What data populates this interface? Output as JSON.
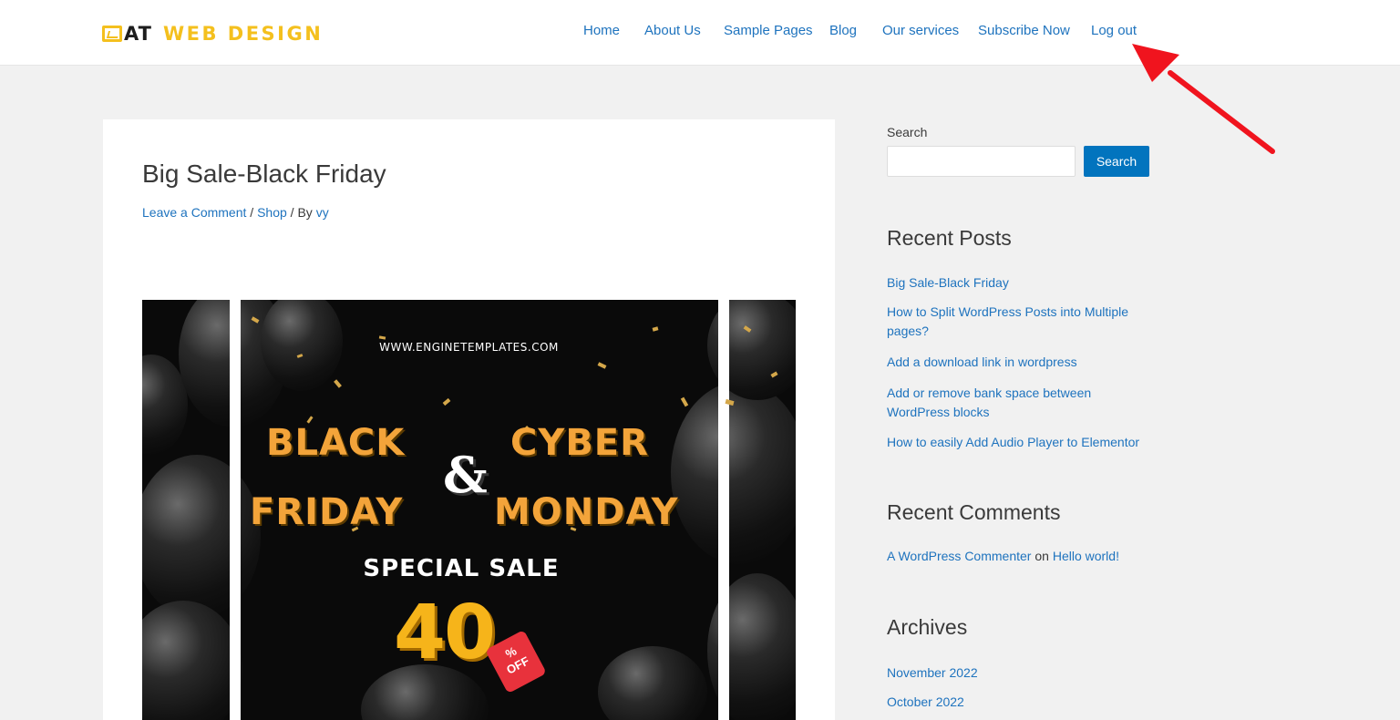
{
  "header": {
    "logo_prefix": "AT",
    "logo_brand": "WEB DESIGN",
    "nav": [
      {
        "label": "Home"
      },
      {
        "label": "About Us"
      },
      {
        "label": "Sample Pages"
      },
      {
        "label": "Blog"
      },
      {
        "label": "Our services"
      },
      {
        "label": "Subscribe Now"
      },
      {
        "label": "Log out"
      }
    ]
  },
  "post": {
    "title": "Big Sale-Black Friday",
    "meta_comment": "Leave a Comment",
    "meta_sep1": " / ",
    "meta_category": "Shop",
    "meta_sep2": " / By ",
    "meta_author": "vy",
    "image": {
      "url_text": "WWW.ENGINETEMPLATES.COM",
      "word_black": "BLACK",
      "word_cyber": "CYBER",
      "word_friday": "FRIDAY",
      "word_monday": "MONDAY",
      "ampersand": "&",
      "special": "SPECIAL SALE",
      "percent": "40",
      "tag_symbol": "%",
      "tag_text": "OFF"
    }
  },
  "sidebar": {
    "search_label": "Search",
    "search_value": "",
    "search_button": "Search",
    "recent_posts_title": "Recent Posts",
    "recent_posts": [
      {
        "label": "Big Sale-Black Friday"
      },
      {
        "label": "How to Split WordPress Posts into Multiple pages?"
      },
      {
        "label": "Add a download link in wordpress"
      },
      {
        "label": "Add or remove bank space between WordPress blocks"
      },
      {
        "label": "How to easily Add Audio Player to Elementor"
      }
    ],
    "recent_comments_title": "Recent Comments",
    "comment_author": "A WordPress Commenter",
    "comment_on": " on ",
    "comment_post": "Hello world!",
    "archives_title": "Archives",
    "archives": [
      {
        "label": "November 2022"
      },
      {
        "label": "October 2022"
      }
    ]
  },
  "colors": {
    "link": "#1e73be",
    "brand_yellow": "#f4c01e",
    "button_blue": "#0274be",
    "annotation_red": "#f0141e"
  }
}
